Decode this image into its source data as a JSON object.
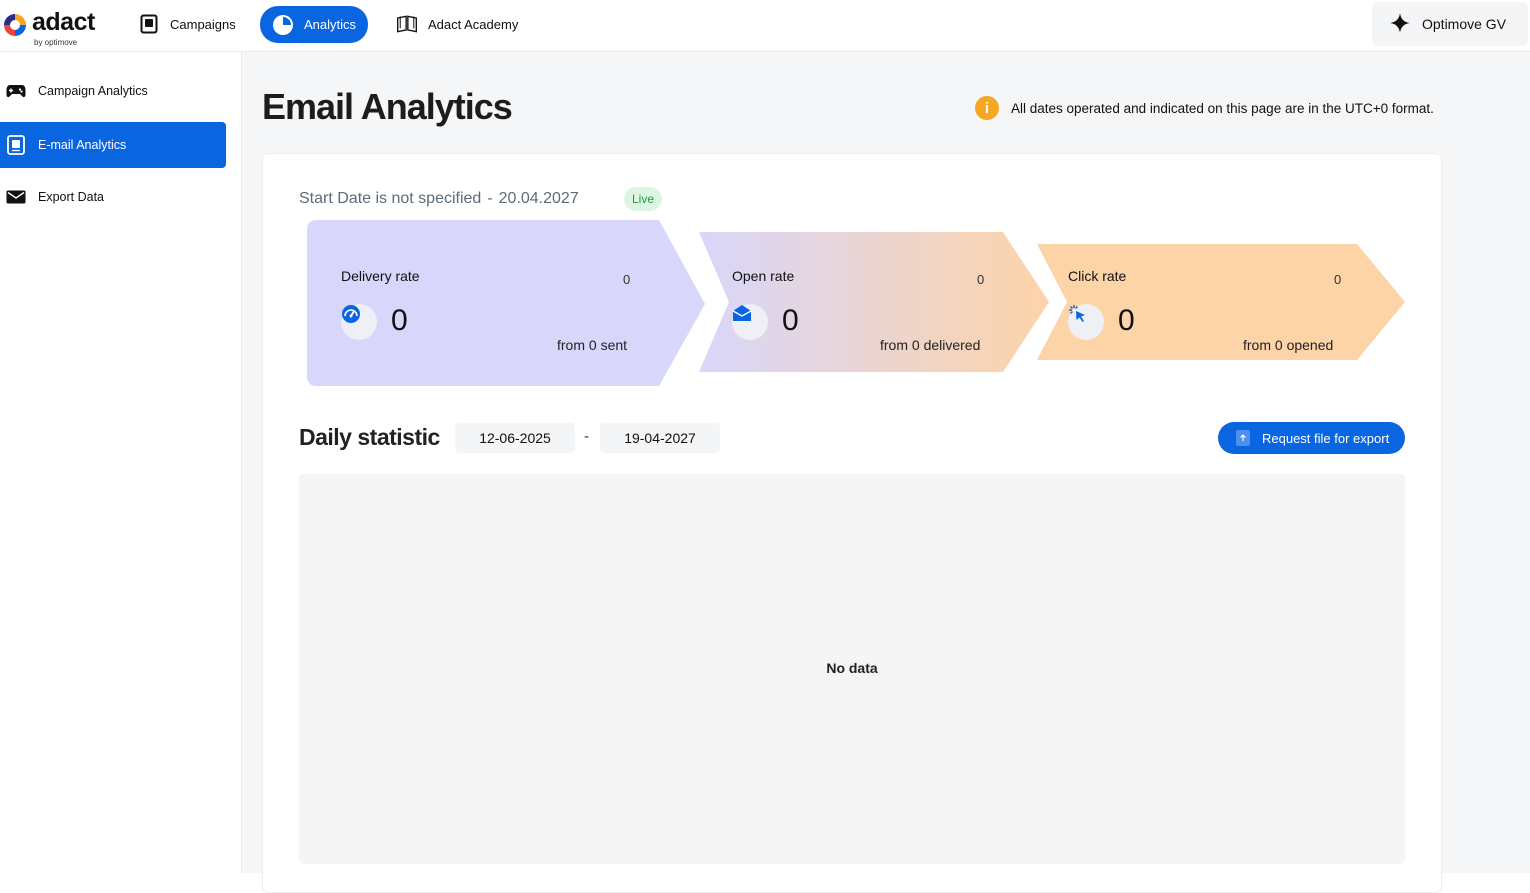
{
  "brand": {
    "name": "adact",
    "tagline": "by optimove"
  },
  "topnav": {
    "items": [
      {
        "label": "Campaigns",
        "icon": "campaigns-icon"
      },
      {
        "label": "Analytics",
        "icon": "pie-chart-icon",
        "active": true
      },
      {
        "label": "Adact Academy",
        "icon": "book-icon"
      }
    ],
    "account": {
      "name": "Optimove GV",
      "icon": "sparkle-icon"
    }
  },
  "sidebar": {
    "items": [
      {
        "label": "Campaign Analytics",
        "icon": "gamepad-icon"
      },
      {
        "label": "E-mail Analytics",
        "icon": "email-card-icon",
        "active": true
      },
      {
        "label": "Export Data",
        "icon": "envelope-icon"
      }
    ]
  },
  "page": {
    "title": "Email Analytics",
    "timezone_note": "All dates operated and indicated on this page are in the UTC+0 format."
  },
  "summary": {
    "start_label": "Start Date is not specified",
    "separator": "-",
    "end_date": "20.04.2027",
    "status": "Live"
  },
  "metrics": [
    {
      "label": "Delivery rate",
      "small_value": "0",
      "value": "0",
      "sub": "from 0 sent",
      "icon": "speedometer-icon"
    },
    {
      "label": "Open rate",
      "small_value": "0",
      "value": "0",
      "sub": "from 0 delivered",
      "icon": "open-envelope-icon"
    },
    {
      "label": "Click rate",
      "small_value": "0",
      "value": "0",
      "sub": "from 0 opened",
      "icon": "cursor-click-icon"
    }
  ],
  "daily": {
    "title": "Daily statistic",
    "date_from": "12-06-2025",
    "date_sep": "-",
    "date_to": "19-04-2027",
    "export_label": "Request file for export",
    "empty_text": "No data"
  },
  "colors": {
    "primary": "#0a66e0",
    "delivery_bg": "#d8d6fa",
    "open_bg_start": "#d8d6fa",
    "open_bg_end": "#fdd3a8",
    "click_bg": "#fdd3a8",
    "live_bg": "#dff5e3",
    "live_text": "#1e9e3a",
    "info": "#f5a623"
  }
}
